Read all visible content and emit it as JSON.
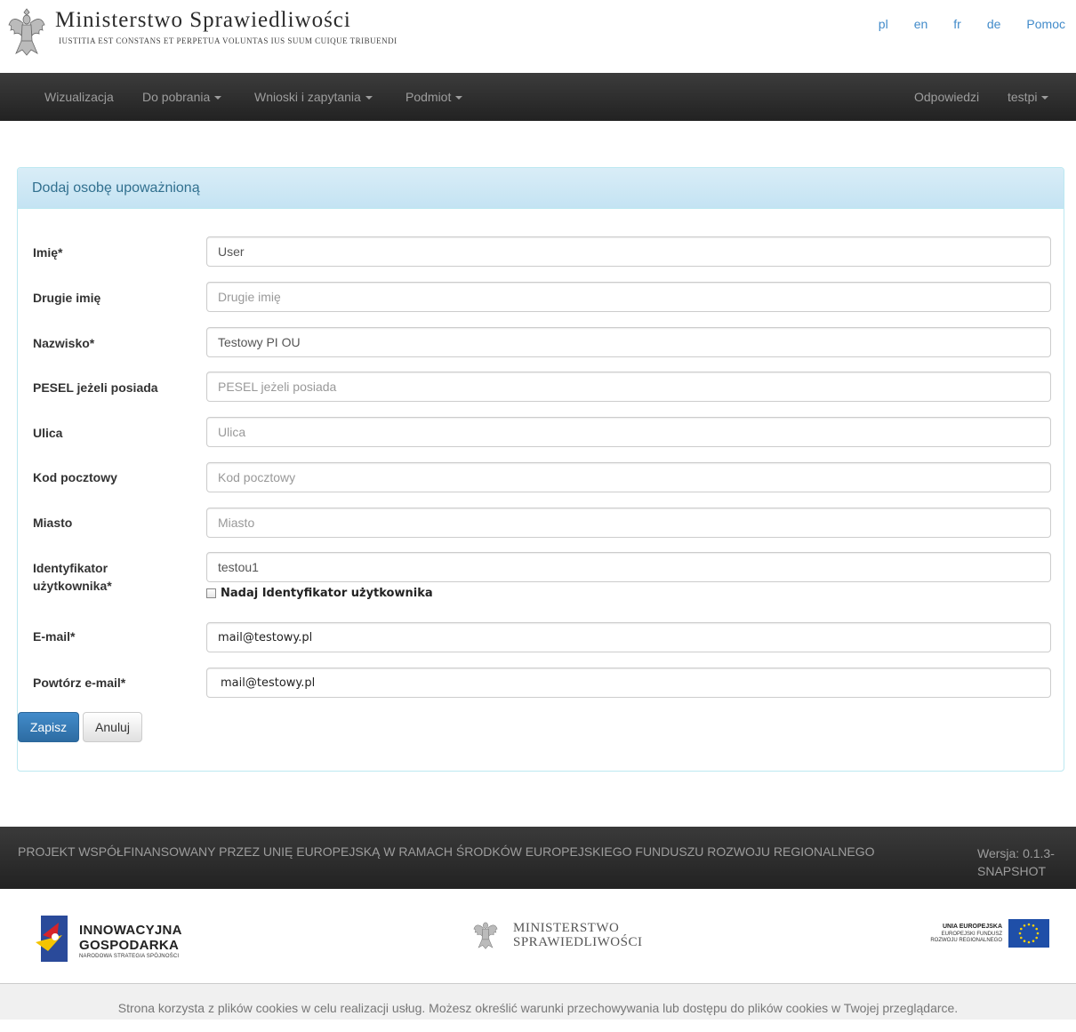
{
  "header": {
    "title": "Ministerstwo Sprawiedliwości",
    "motto": "Iustitia est constans et perpetua voluntas ius suum cuique tribuendi",
    "languages": [
      "pl",
      "en",
      "fr",
      "de",
      "Pomoc"
    ]
  },
  "navbar": {
    "left": [
      {
        "label": "Wizualizacja",
        "dropdown": false
      },
      {
        "label": "Do pobrania",
        "dropdown": true
      },
      {
        "label": "Wnioski i zapytania",
        "dropdown": true
      },
      {
        "label": "Podmiot",
        "dropdown": true
      }
    ],
    "right": [
      {
        "label": "Odpowiedzi",
        "dropdown": false
      },
      {
        "label": "testpi",
        "dropdown": true
      }
    ]
  },
  "form": {
    "heading": "Dodaj osobę upoważnioną",
    "fields": [
      {
        "label": "Imię*",
        "value": "User",
        "placeholder": ""
      },
      {
        "label": "Drugie imię",
        "value": "",
        "placeholder": "Drugie imię"
      },
      {
        "label": "Nazwisko*",
        "value": "Testowy PI OU",
        "placeholder": ""
      },
      {
        "label": "PESEL jeżeli posiada",
        "value": "",
        "placeholder": "PESEL jeżeli posiada"
      },
      {
        "label": "Ulica",
        "value": "",
        "placeholder": "Ulica"
      },
      {
        "label": "Kod pocztowy",
        "value": "",
        "placeholder": "Kod pocztowy"
      },
      {
        "label": "Miasto",
        "value": "",
        "placeholder": "Miasto"
      },
      {
        "label_line1": "Identyfikator",
        "label_line2": "użytkownika*",
        "value": "testou1",
        "placeholder": ""
      },
      {
        "label": "E-mail*",
        "value": "mail@testowy.pl",
        "placeholder": ""
      },
      {
        "label": "Powtórz e-mail*",
        "value": "mail@testowy.pl",
        "placeholder": ""
      }
    ],
    "checkbox_label": "Nadaj Identyfikator użytkownika",
    "checkbox_checked": false,
    "save_label": "Zapisz",
    "cancel_label": "Anuluj"
  },
  "footer": {
    "project_text": "PROJEKT WSPÓŁFINANSOWANY PRZEZ UNIĘ EUROPEJSKĄ W RAMACH ŚRODKÓW EUROPEJSKIEGO FUNDUSZU ROZWOJU REGIONALNEGO",
    "version": "Wersja: 0.1.3-SNAPSHOT"
  },
  "logos": {
    "ig_line1": "INNOWACYJNA",
    "ig_line2": "GOSPODARKA",
    "ig_line3": "NARODOWA STRATEGIA SPÓJNOŚCI",
    "ms_line1": "MINISTERSTWO",
    "ms_line2": "SPRAWIEDLIWOŚCI",
    "eu_line1": "UNIA EUROPEJSKA",
    "eu_line2": "EUROPEJSKI FUNDUSZ",
    "eu_line3": "ROZWOJU REGIONALNEGO"
  },
  "cookie_text": "Strona korzysta z plików cookies w celu realizacji usług. Możesz określić warunki przechowywania lub dostępu do plików cookies w Twojej przeglądarce.",
  "colors": {
    "navbar": "#222222",
    "link": "#428bca",
    "panel_heading": "#d9edf7",
    "primary_button": "#428bca"
  }
}
